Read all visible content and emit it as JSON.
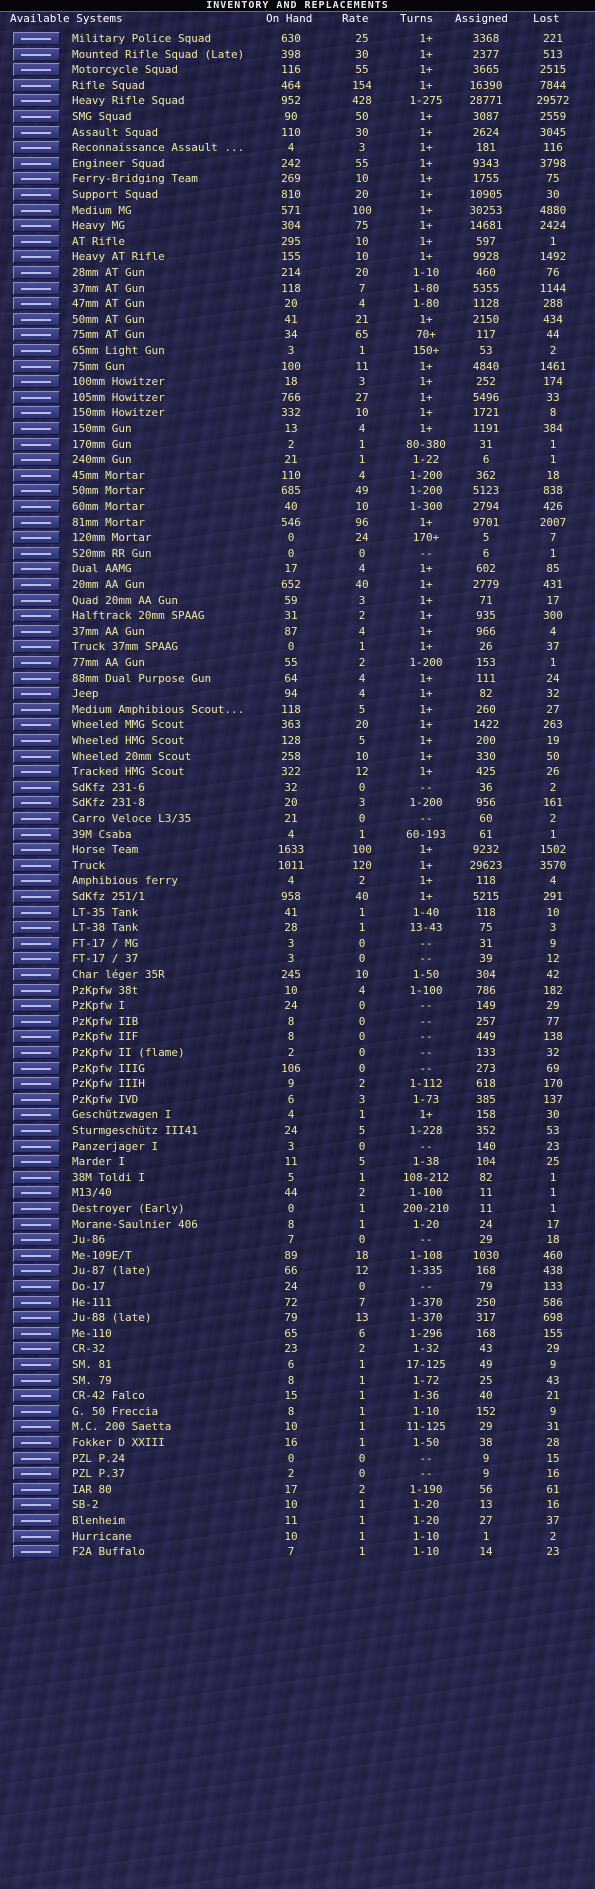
{
  "window": {
    "title": "INVENTORY AND REPLACEMENTS"
  },
  "columns": {
    "name": "Available Systems",
    "on_hand": "On Hand",
    "rate": "Rate",
    "turns": "Turns",
    "assigned": "Assigned",
    "lost": "Lost"
  },
  "colors": {
    "text": "#ece6a0",
    "header": "#ffffff",
    "icon_bg": "#3c4084"
  },
  "systems": [
    [
      "Military Police Squad",
      "630",
      "25",
      "1+",
      "3368",
      "221"
    ],
    [
      "Mounted Rifle Squad (Late)",
      "398",
      "30",
      "1+",
      "2377",
      "513"
    ],
    [
      "Motorcycle Squad",
      "116",
      "55",
      "1+",
      "3665",
      "2515"
    ],
    [
      "Rifle Squad",
      "464",
      "154",
      "1+",
      "16390",
      "7844"
    ],
    [
      "Heavy Rifle Squad",
      "952",
      "428",
      "1-275",
      "28771",
      "29572"
    ],
    [
      "SMG Squad",
      "90",
      "50",
      "1+",
      "3087",
      "2559"
    ],
    [
      "Assault Squad",
      "110",
      "30",
      "1+",
      "2624",
      "3045"
    ],
    [
      "Reconnaissance Assault ...",
      "4",
      "3",
      "1+",
      "181",
      "116"
    ],
    [
      "Engineer Squad",
      "242",
      "55",
      "1+",
      "9343",
      "3798"
    ],
    [
      "Ferry-Bridging Team",
      "269",
      "10",
      "1+",
      "1755",
      "75"
    ],
    [
      "Support Squad",
      "810",
      "20",
      "1+",
      "10905",
      "30"
    ],
    [
      "Medium MG",
      "571",
      "100",
      "1+",
      "30253",
      "4880"
    ],
    [
      "Heavy MG",
      "304",
      "75",
      "1+",
      "14681",
      "2424"
    ],
    [
      "AT Rifle",
      "295",
      "10",
      "1+",
      "597",
      "1"
    ],
    [
      "Heavy AT Rifle",
      "155",
      "10",
      "1+",
      "9928",
      "1492"
    ],
    [
      "28mm AT Gun",
      "214",
      "20",
      "1-10",
      "460",
      "76"
    ],
    [
      "37mm AT Gun",
      "118",
      "7",
      "1-80",
      "5355",
      "1144"
    ],
    [
      "47mm AT Gun",
      "20",
      "4",
      "1-80",
      "1128",
      "288"
    ],
    [
      "50mm AT Gun",
      "41",
      "21",
      "1+",
      "2150",
      "434"
    ],
    [
      "75mm AT Gun",
      "34",
      "65",
      "70+",
      "117",
      "44"
    ],
    [
      "65mm Light Gun",
      "3",
      "1",
      "150+",
      "53",
      "2"
    ],
    [
      "75mm Gun",
      "100",
      "11",
      "1+",
      "4840",
      "1461"
    ],
    [
      "100mm Howitzer",
      "18",
      "3",
      "1+",
      "252",
      "174"
    ],
    [
      "105mm Howitzer",
      "766",
      "27",
      "1+",
      "5496",
      "33"
    ],
    [
      "150mm Howitzer",
      "332",
      "10",
      "1+",
      "1721",
      "8"
    ],
    [
      "150mm Gun",
      "13",
      "4",
      "1+",
      "1191",
      "384"
    ],
    [
      "170mm Gun",
      "2",
      "1",
      "80-380",
      "31",
      "1"
    ],
    [
      "240mm Gun",
      "21",
      "1",
      "1-22",
      "6",
      "1"
    ],
    [
      "45mm Mortar",
      "110",
      "4",
      "1-200",
      "362",
      "18"
    ],
    [
      "50mm Mortar",
      "685",
      "49",
      "1-200",
      "5123",
      "838"
    ],
    [
      "60mm Mortar",
      "40",
      "10",
      "1-300",
      "2794",
      "426"
    ],
    [
      "81mm Mortar",
      "546",
      "96",
      "1+",
      "9701",
      "2007"
    ],
    [
      "120mm Mortar",
      "0",
      "24",
      "170+",
      "5",
      "7"
    ],
    [
      "520mm RR Gun",
      "0",
      "0",
      "--",
      "6",
      "1"
    ],
    [
      "Dual AAMG",
      "17",
      "4",
      "1+",
      "602",
      "85"
    ],
    [
      "20mm AA Gun",
      "652",
      "40",
      "1+",
      "2779",
      "431"
    ],
    [
      "Quad 20mm AA Gun",
      "59",
      "3",
      "1+",
      "71",
      "17"
    ],
    [
      "Halftrack 20mm SPAAG",
      "31",
      "2",
      "1+",
      "935",
      "300"
    ],
    [
      "37mm AA Gun",
      "87",
      "4",
      "1+",
      "966",
      "4"
    ],
    [
      "Truck 37mm SPAAG",
      "0",
      "1",
      "1+",
      "26",
      "37"
    ],
    [
      "77mm AA Gun",
      "55",
      "2",
      "1-200",
      "153",
      "1"
    ],
    [
      "88mm Dual Purpose Gun",
      "64",
      "4",
      "1+",
      "111",
      "24"
    ],
    [
      "Jeep",
      "94",
      "4",
      "1+",
      "82",
      "32"
    ],
    [
      "Medium Amphibious Scout...",
      "118",
      "5",
      "1+",
      "260",
      "27"
    ],
    [
      "Wheeled MMG Scout",
      "363",
      "20",
      "1+",
      "1422",
      "263"
    ],
    [
      "Wheeled HMG Scout",
      "128",
      "5",
      "1+",
      "200",
      "19"
    ],
    [
      "Wheeled 20mm Scout",
      "258",
      "10",
      "1+",
      "330",
      "50"
    ],
    [
      "Tracked HMG Scout",
      "322",
      "12",
      "1+",
      "425",
      "26"
    ],
    [
      "SdKfz 231-6",
      "32",
      "0",
      "--",
      "36",
      "2"
    ],
    [
      "SdKfz 231-8",
      "20",
      "3",
      "1-200",
      "956",
      "161"
    ],
    [
      "Carro Veloce L3/35",
      "21",
      "0",
      "--",
      "60",
      "2"
    ],
    [
      "39M Csaba",
      "4",
      "1",
      "60-193",
      "61",
      "1"
    ],
    [
      "Horse Team",
      "1633",
      "100",
      "1+",
      "9232",
      "1502"
    ],
    [
      "Truck",
      "1011",
      "120",
      "1+",
      "29623",
      "3570"
    ],
    [
      "Amphibious ferry",
      "4",
      "2",
      "1+",
      "118",
      "4"
    ],
    [
      "SdKfz 251/1",
      "958",
      "40",
      "1+",
      "5215",
      "291"
    ],
    [
      "LT-35 Tank",
      "41",
      "1",
      "1-40",
      "118",
      "10"
    ],
    [
      "LT-38 Tank",
      "28",
      "1",
      "13-43",
      "75",
      "3"
    ],
    [
      "FT-17 / MG",
      "3",
      "0",
      "--",
      "31",
      "9"
    ],
    [
      "FT-17 / 37",
      "3",
      "0",
      "--",
      "39",
      "12"
    ],
    [
      "Char léger 35R",
      "245",
      "10",
      "1-50",
      "304",
      "42"
    ],
    [
      "PzKpfw 38t",
      "10",
      "4",
      "1-100",
      "786",
      "182"
    ],
    [
      "PzKpfw I",
      "24",
      "0",
      "--",
      "149",
      "29"
    ],
    [
      "PzKpfw IIB",
      "8",
      "0",
      "--",
      "257",
      "77"
    ],
    [
      "PzKpfw IIF",
      "8",
      "0",
      "--",
      "449",
      "138"
    ],
    [
      "PzKpfw II (flame)",
      "2",
      "0",
      "--",
      "133",
      "32"
    ],
    [
      "PzKpfw IIIG",
      "106",
      "0",
      "--",
      "273",
      "69"
    ],
    [
      "PzKpfw IIIH",
      "9",
      "2",
      "1-112",
      "618",
      "170"
    ],
    [
      "PzKpfw IVD",
      "6",
      "3",
      "1-73",
      "385",
      "137"
    ],
    [
      "Geschützwagen I",
      "4",
      "1",
      "1+",
      "158",
      "30"
    ],
    [
      "Sturmgeschütz III41",
      "24",
      "5",
      "1-228",
      "352",
      "53"
    ],
    [
      "Panzerjager I",
      "3",
      "0",
      "--",
      "140",
      "23"
    ],
    [
      "Marder I",
      "11",
      "5",
      "1-38",
      "104",
      "25"
    ],
    [
      "38M Toldi I",
      "5",
      "1",
      "108-212",
      "82",
      "1"
    ],
    [
      "M13/40",
      "44",
      "2",
      "1-100",
      "11",
      "1"
    ],
    [
      "Destroyer (Early)",
      "0",
      "1",
      "200-210",
      "11",
      "1"
    ],
    [
      "Morane-Saulnier 406",
      "8",
      "1",
      "1-20",
      "24",
      "17"
    ],
    [
      "Ju-86",
      "7",
      "0",
      "--",
      "29",
      "18"
    ],
    [
      "Me-109E/T",
      "89",
      "18",
      "1-108",
      "1030",
      "460"
    ],
    [
      "Ju-87 (late)",
      "66",
      "12",
      "1-335",
      "168",
      "438"
    ],
    [
      "Do-17",
      "24",
      "0",
      "--",
      "79",
      "133"
    ],
    [
      "He-111",
      "72",
      "7",
      "1-370",
      "250",
      "586"
    ],
    [
      "Ju-88 (late)",
      "79",
      "13",
      "1-370",
      "317",
      "698"
    ],
    [
      "Me-110",
      "65",
      "6",
      "1-296",
      "168",
      "155"
    ],
    [
      "CR-32",
      "23",
      "2",
      "1-32",
      "43",
      "29"
    ],
    [
      "SM. 81",
      "6",
      "1",
      "17-125",
      "49",
      "9"
    ],
    [
      "SM. 79",
      "8",
      "1",
      "1-72",
      "25",
      "43"
    ],
    [
      "CR-42 Falco",
      "15",
      "1",
      "1-36",
      "40",
      "21"
    ],
    [
      "G. 50 Freccia",
      "8",
      "1",
      "1-10",
      "152",
      "9"
    ],
    [
      "M.C. 200 Saetta",
      "10",
      "1",
      "11-125",
      "29",
      "31"
    ],
    [
      "Fokker D XXIII",
      "16",
      "1",
      "1-50",
      "38",
      "28"
    ],
    [
      "PZL P.24",
      "0",
      "0",
      "--",
      "9",
      "15"
    ],
    [
      "PZL P.37",
      "2",
      "0",
      "--",
      "9",
      "16"
    ],
    [
      "IAR 80",
      "17",
      "2",
      "1-190",
      "56",
      "61"
    ],
    [
      "SB-2",
      "10",
      "1",
      "1-20",
      "13",
      "16"
    ],
    [
      "Blenheim",
      "11",
      "1",
      "1-20",
      "27",
      "37"
    ],
    [
      "Hurricane",
      "10",
      "1",
      "1-10",
      "1",
      "2"
    ],
    [
      "F2A Buffalo",
      "7",
      "1",
      "1-10",
      "14",
      "23"
    ]
  ]
}
